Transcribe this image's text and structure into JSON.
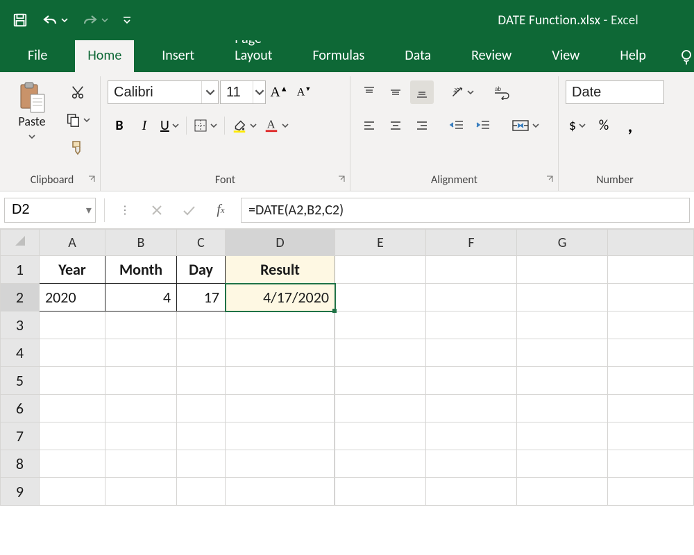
{
  "title": {
    "file": "DATE Function.xlsx",
    "sep": "  -  ",
    "app": "Excel"
  },
  "tabs": {
    "file": "File",
    "home": "Home",
    "insert": "Insert",
    "pagelayout": "Page Layout",
    "formulas": "Formulas",
    "data": "Data",
    "review": "Review",
    "view": "View",
    "help": "Help",
    "active": "home"
  },
  "clipboard": {
    "paste": "Paste",
    "label": "Clipboard"
  },
  "font": {
    "name": "Calibri",
    "size": "11",
    "label": "Font"
  },
  "alignment": {
    "label": "Alignment"
  },
  "number": {
    "label": "Number",
    "format": "Date"
  },
  "namebox": "D2",
  "formula": "=DATE(A2,B2,C2)",
  "columns": [
    "A",
    "B",
    "C",
    "D",
    "E",
    "F",
    "G"
  ],
  "rows": [
    "1",
    "2",
    "3",
    "4",
    "5",
    "6",
    "7",
    "8",
    "9"
  ],
  "selected": {
    "col": "D",
    "row": "2"
  },
  "cells": {
    "A1": "Year",
    "B1": "Month",
    "C1": "Day",
    "D1": "Result",
    "A2": "2020",
    "B2": "4",
    "C2": "17",
    "D2": "4/17/2020"
  },
  "widths": {
    "corner": 56,
    "A": 95,
    "B": 103,
    "C": 70,
    "D": 158,
    "E": 131,
    "F": 131,
    "G": 131
  }
}
